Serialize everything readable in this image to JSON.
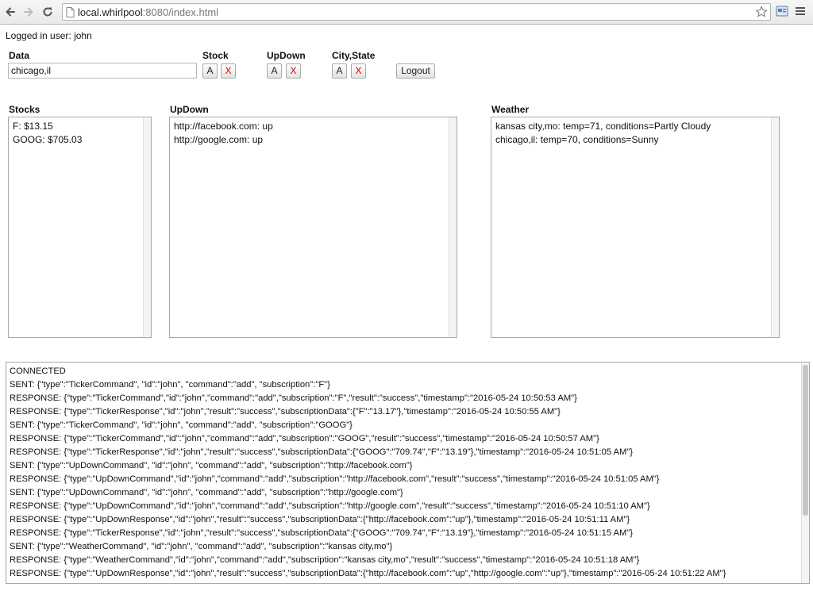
{
  "browser": {
    "url_host": "local.whirlpool",
    "url_path": ":8080/index.html"
  },
  "page": {
    "logged_in_text": "Logged in user: john",
    "data_label": "Data",
    "data_value": "chicago,il",
    "stock_label": "Stock",
    "updown_label": "UpDown",
    "citystate_label": "City,State",
    "add_label": "A",
    "remove_label": "X",
    "logout_label": "Logout"
  },
  "stocks": {
    "title": "Stocks",
    "items": [
      "F: $13.15",
      "GOOG: $705.03"
    ]
  },
  "updown": {
    "title": "UpDown",
    "items": [
      "http://facebook.com: up",
      "http://google.com: up"
    ]
  },
  "weather": {
    "title": "Weather",
    "items": [
      "kansas city,mo: temp=71, conditions=Partly Cloudy",
      "chicago,il: temp=70, conditions=Sunny"
    ]
  },
  "log": {
    "lines": [
      "CONNECTED",
      "SENT: {\"type\":\"TickerCommand\", \"id\":\"john\", \"command\":\"add\", \"subscription\":\"F\"}",
      "RESPONSE: {\"type\":\"TickerCommand\",\"id\":\"john\",\"command\":\"add\",\"subscription\":\"F\",\"result\":\"success\",\"timestamp\":\"2016-05-24 10:50:53 AM\"}",
      "RESPONSE: {\"type\":\"TickerResponse\",\"id\":\"john\",\"result\":\"success\",\"subscriptionData\":{\"F\":\"13.17\"},\"timestamp\":\"2016-05-24 10:50:55 AM\"}",
      "SENT: {\"type\":\"TickerCommand\", \"id\":\"john\", \"command\":\"add\", \"subscription\":\"GOOG\"}",
      "RESPONSE: {\"type\":\"TickerCommand\",\"id\":\"john\",\"command\":\"add\",\"subscription\":\"GOOG\",\"result\":\"success\",\"timestamp\":\"2016-05-24 10:50:57 AM\"}",
      "RESPONSE: {\"type\":\"TickerResponse\",\"id\":\"john\",\"result\":\"success\",\"subscriptionData\":{\"GOOG\":\"709.74\",\"F\":\"13.19\"},\"timestamp\":\"2016-05-24 10:51:05 AM\"}",
      "SENT: {\"type\":\"UpDownCommand\", \"id\":\"john\", \"command\":\"add\", \"subscription\":\"http://facebook.com\"}",
      "RESPONSE: {\"type\":\"UpDownCommand\",\"id\":\"john\",\"command\":\"add\",\"subscription\":\"http://facebook.com\",\"result\":\"success\",\"timestamp\":\"2016-05-24 10:51:05 AM\"}",
      "SENT: {\"type\":\"UpDownCommand\", \"id\":\"john\", \"command\":\"add\", \"subscription\":\"http://google.com\"}",
      "RESPONSE: {\"type\":\"UpDownCommand\",\"id\":\"john\",\"command\":\"add\",\"subscription\":\"http://google.com\",\"result\":\"success\",\"timestamp\":\"2016-05-24 10:51:10 AM\"}",
      "RESPONSE: {\"type\":\"UpDownResponse\",\"id\":\"john\",\"result\":\"success\",\"subscriptionData\":{\"http://facebook.com\":\"up\"},\"timestamp\":\"2016-05-24 10:51:11 AM\"}",
      "RESPONSE: {\"type\":\"TickerResponse\",\"id\":\"john\",\"result\":\"success\",\"subscriptionData\":{\"GOOG\":\"709.74\",\"F\":\"13.19\"},\"timestamp\":\"2016-05-24 10:51:15 AM\"}",
      "SENT: {\"type\":\"WeatherCommand\", \"id\":\"john\", \"command\":\"add\", \"subscription\":\"kansas city,mo\"}",
      "RESPONSE: {\"type\":\"WeatherCommand\",\"id\":\"john\",\"command\":\"add\",\"subscription\":\"kansas city,mo\",\"result\":\"success\",\"timestamp\":\"2016-05-24 10:51:18 AM\"}",
      "RESPONSE: {\"type\":\"UpDownResponse\",\"id\":\"john\",\"result\":\"success\",\"subscriptionData\":{\"http://facebook.com\":\"up\",\"http://google.com\":\"up\"},\"timestamp\":\"2016-05-24 10:51:22 AM\"}"
    ]
  },
  "icons": {
    "back": "back-arrow-icon",
    "forward": "forward-arrow-icon",
    "reload": "reload-icon",
    "page": "page-icon",
    "star": "star-icon",
    "extension": "extension-icon",
    "menu": "hamburger-menu-icon"
  },
  "colors": {
    "remove_button_text": "#d60000",
    "panel_border": "#a9a9a9"
  }
}
